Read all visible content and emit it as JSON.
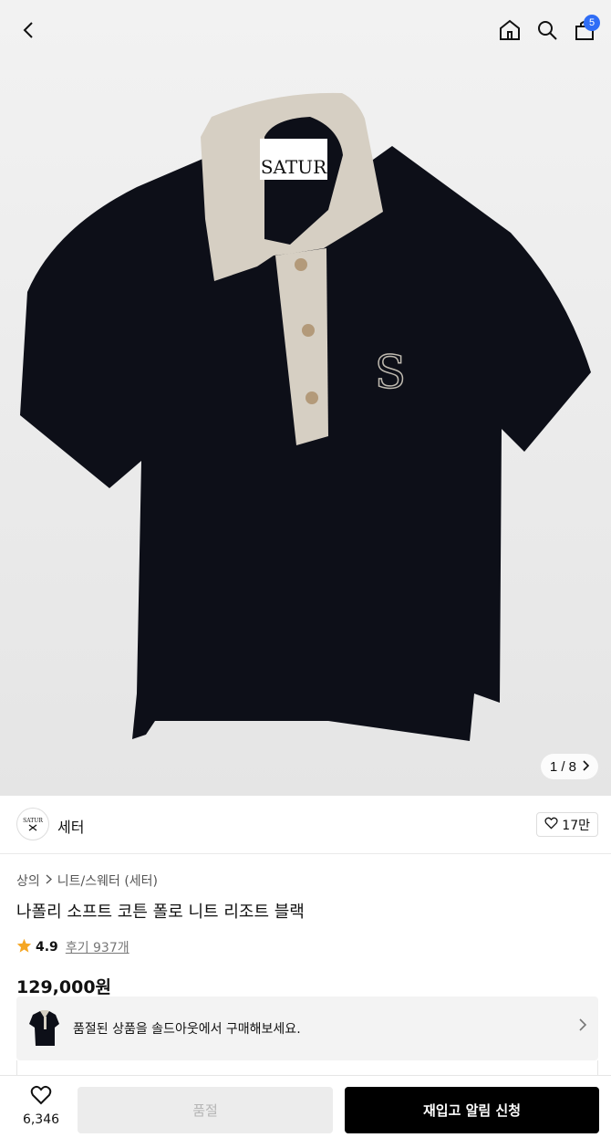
{
  "header": {
    "cart_count": "5",
    "icons": [
      "back-arrow-icon",
      "home-icon",
      "search-icon",
      "shopping-bag-icon"
    ]
  },
  "gallery": {
    "indicator": "1 / 8",
    "label_text": "SATUR"
  },
  "brand": {
    "logo_text": "SATUR",
    "name": "세터",
    "likes": "17만"
  },
  "product": {
    "breadcrumb": [
      "상의",
      "니트/스웨터 (세터)"
    ],
    "title": "나폴리 소프트 코튼 폴로 니트 리조트 블랙",
    "rating": "4.9",
    "reviews": "후기 937개",
    "price": "129,000원",
    "star_color": "#f5a623"
  },
  "soldout_banner": {
    "text": "품절된 상품을 솔드아웃에서 구매해보세요."
  },
  "bottom_bar": {
    "wish_count": "6,346",
    "sold_out_label": "품절",
    "restock_label": "재입고 알림 신청",
    "accent": "#000000"
  }
}
